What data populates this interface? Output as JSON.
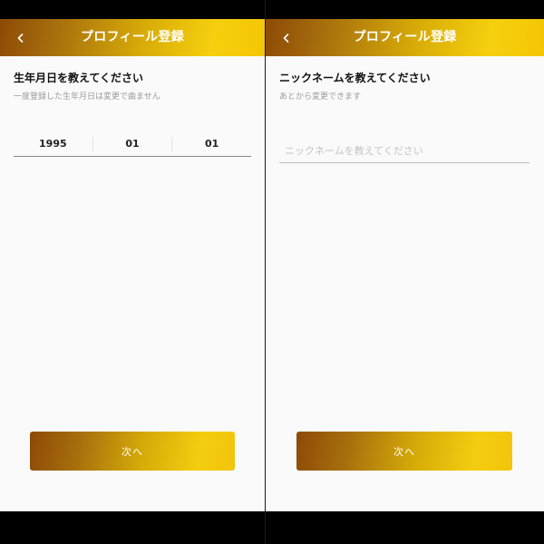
{
  "left_screen": {
    "header": {
      "title": "プロフィール登録",
      "back_icon": "chevron-left-icon"
    },
    "section": {
      "title": "生年月日を教えてください",
      "subtitle": "一度登録した生年月日は変更で曲ません"
    },
    "birthdate": {
      "year": "1995",
      "month": "01",
      "day": "01"
    },
    "next_label": "次へ"
  },
  "right_screen": {
    "header": {
      "title": "プロフィール登録",
      "back_icon": "chevron-left-icon"
    },
    "section": {
      "title": "ニックネームを教えてください",
      "subtitle": "あとから変更できます"
    },
    "nickname": {
      "value": "",
      "placeholder": "ニックネームを教えてください"
    },
    "next_label": "次へ"
  },
  "colors": {
    "header_gradient_start": "#8c4a06",
    "header_gradient_end": "#f6cf0e",
    "background": "#fafafa",
    "button_text": "#ffffff"
  }
}
